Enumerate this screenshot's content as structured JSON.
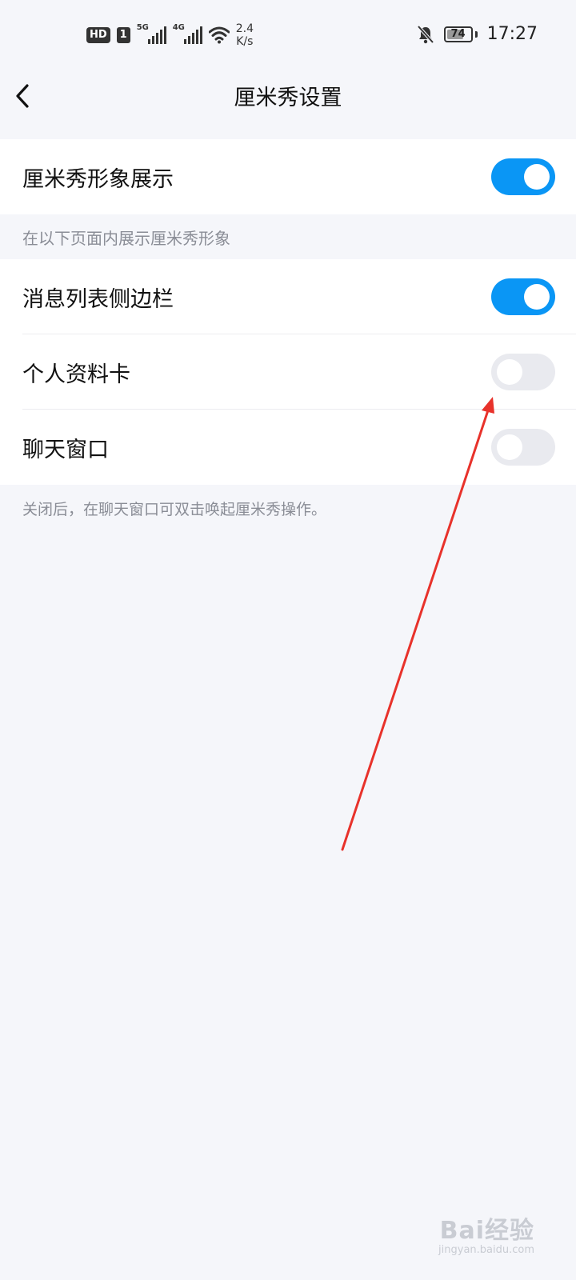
{
  "status_bar": {
    "hd_label": "HD",
    "sim_label": "1",
    "net1": "5G",
    "net2": "4G",
    "speed_value": "2.4",
    "speed_unit": "K/s",
    "battery_percent": "74",
    "battery_level": 74,
    "time": "17:27"
  },
  "nav": {
    "title": "厘米秀设置",
    "back_icon": "chevron-left-icon"
  },
  "main_toggle": {
    "label": "厘米秀形象展示",
    "on": true
  },
  "section": {
    "label": "在以下页面内展示厘米秀形象"
  },
  "pages": [
    {
      "label": "消息列表侧边栏",
      "on": true
    },
    {
      "label": "个人资料卡",
      "on": false
    },
    {
      "label": "聊天窗口",
      "on": false
    }
  ],
  "footer_note": "关闭后，在聊天窗口可双击唤起厘米秀操作。",
  "watermark": {
    "brand": "Bai经验",
    "url": "jingyan.baidu.com"
  },
  "colors": {
    "toggle_on": "#0a96f5",
    "toggle_off": "#e9eaef",
    "annotation_arrow": "#e8322b",
    "background": "#f5f6fa"
  }
}
